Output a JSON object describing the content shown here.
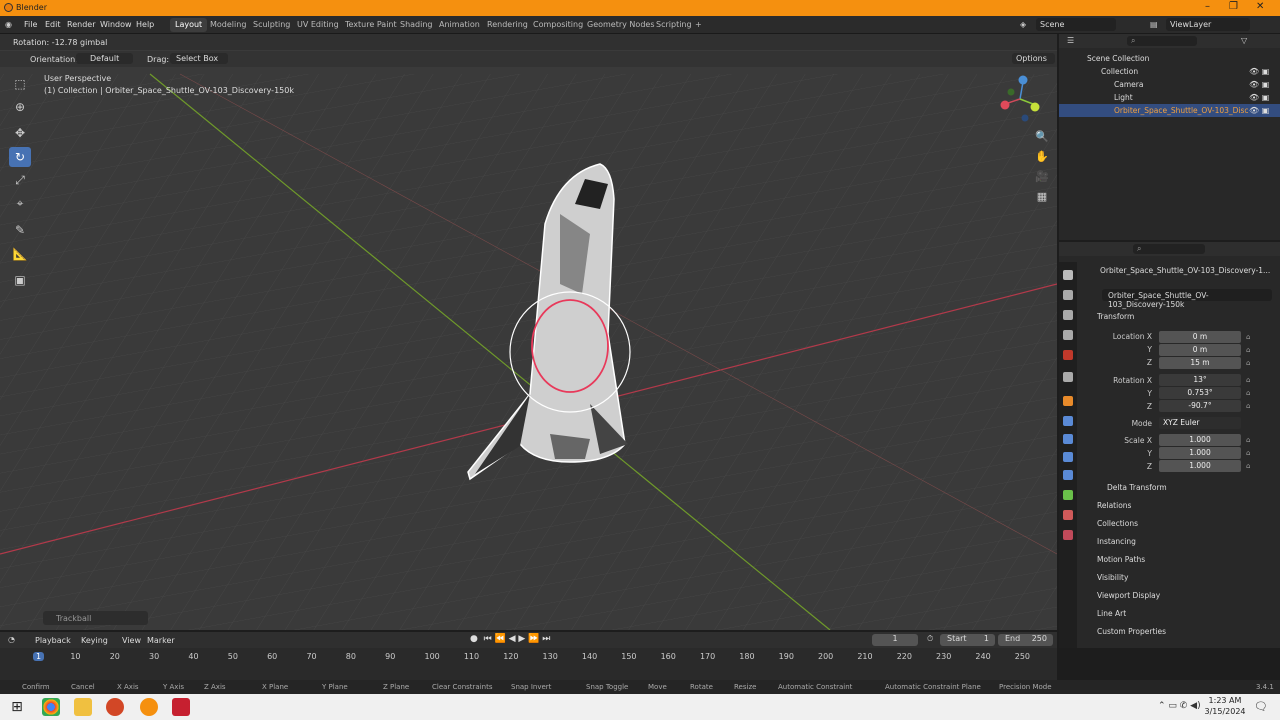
{
  "window": {
    "title": "Blender"
  },
  "menu": [
    "File",
    "Edit",
    "Render",
    "Window",
    "Help"
  ],
  "workspaces": [
    "Layout",
    "Modeling",
    "Sculpting",
    "UV Editing",
    "Texture Paint",
    "Shading",
    "Animation",
    "Rendering",
    "Compositing",
    "Geometry Nodes",
    "Scripting",
    "+"
  ],
  "scene": "Scene",
  "view_layer": "ViewLayer",
  "header": {
    "rotation": "Rotation: -12.78 gimbal",
    "orientation_label": "Orientation:",
    "orientation_value": "Default",
    "drag_label": "Drag:",
    "drag_value": "Select Box",
    "options": "Options"
  },
  "viewport": {
    "perspective": "User Perspective",
    "collection": "(1) Collection | Orbiter_Space_Shuttle_OV-103_Discovery-150k",
    "operator": "Trackball"
  },
  "outliner": {
    "rows": [
      "Scene Collection",
      "Collection",
      "Camera",
      "Light",
      "Orbiter_Space_Shuttle_OV-103_Disc"
    ]
  },
  "properties": {
    "object_name": "Orbiter_Space_Shuttle_OV-103_Discovery-1...",
    "datablock": "Orbiter_Space_Shuttle_OV-103_Discovery-150k",
    "transform": "Transform",
    "location_x_label": "Location X",
    "y": "Y",
    "z": "Z",
    "location": [
      "0 m",
      "0 m",
      "15 m"
    ],
    "rotation_x_label": "Rotation X",
    "rotation": [
      "13°",
      "0.753°",
      "-90.7°"
    ],
    "mode_label": "Mode",
    "mode": "XYZ Euler",
    "scale_x_label": "Scale X",
    "scale": [
      "1.000",
      "1.000",
      "1.000"
    ],
    "delta": "Delta Transform",
    "panels": [
      "Relations",
      "Collections",
      "Instancing",
      "Motion Paths",
      "Visibility",
      "Viewport Display",
      "Line Art",
      "Custom Properties"
    ]
  },
  "timeline": {
    "menus": [
      "Playback",
      "Keying",
      "View",
      "Marker"
    ],
    "current": "1",
    "start_label": "Start",
    "start": "1",
    "end_label": "End",
    "end": "250",
    "ticks": [
      "1",
      "10",
      "20",
      "30",
      "40",
      "50",
      "60",
      "70",
      "80",
      "90",
      "100",
      "110",
      "120",
      "130",
      "140",
      "150",
      "160",
      "170",
      "180",
      "190",
      "200",
      "210",
      "220",
      "230",
      "240",
      "250"
    ]
  },
  "status": [
    "Confirm",
    "Cancel",
    "X Axis",
    "Y Axis",
    "Z Axis",
    "X Plane",
    "Y Plane",
    "Z Plane",
    "Clear Constraints",
    "Snap Invert",
    "Snap Toggle",
    "Move",
    "Rotate",
    "Resize",
    "Automatic Constraint",
    "Automatic Constraint Plane",
    "Precision Mode"
  ],
  "version": "3.4.1",
  "clock": {
    "time": "1:23 AM",
    "date": "3/15/2024"
  }
}
